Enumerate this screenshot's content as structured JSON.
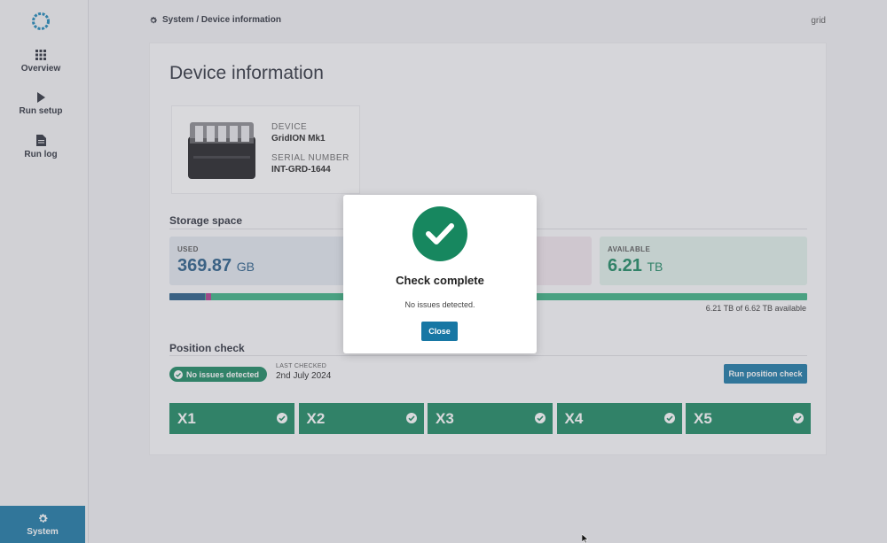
{
  "sidebar": {
    "items": [
      {
        "label": "Overview",
        "icon": "grid-icon"
      },
      {
        "label": "Run setup",
        "icon": "play-icon"
      },
      {
        "label": "Run log",
        "icon": "document-icon"
      }
    ],
    "system": {
      "label": "System",
      "icon": "gear-icon"
    }
  },
  "header": {
    "breadcrumb": "System / Device information",
    "user": "grid"
  },
  "page": {
    "title": "Device information"
  },
  "device": {
    "device_label": "DEVICE",
    "device_value": "GridION Mk1",
    "serial_label": "SERIAL NUMBER",
    "serial_value": "INT-GRD-1644"
  },
  "storage": {
    "title": "Storage space",
    "used_label": "USED",
    "used_value": "369.87",
    "used_unit": "GB",
    "available_label": "AVAILABLE",
    "available_value": "6.21",
    "available_unit": "TB",
    "caption": "6.21 TB of 6.62 TB available",
    "used_fraction": 0.055,
    "other_fraction": 0.008
  },
  "position_check": {
    "title": "Position check",
    "badge": "No issues detected",
    "last_checked_label": "LAST CHECKED",
    "last_checked_value": "2nd July 2024",
    "run_button": "Run position check",
    "positions": [
      "X1",
      "X2",
      "X3",
      "X4",
      "X5"
    ]
  },
  "modal": {
    "title": "Check complete",
    "message": "No issues detected.",
    "close": "Close"
  },
  "colors": {
    "accent": "#1777a4",
    "success": "#17875f",
    "used": "#245a86",
    "available_bar": "#39b283"
  }
}
